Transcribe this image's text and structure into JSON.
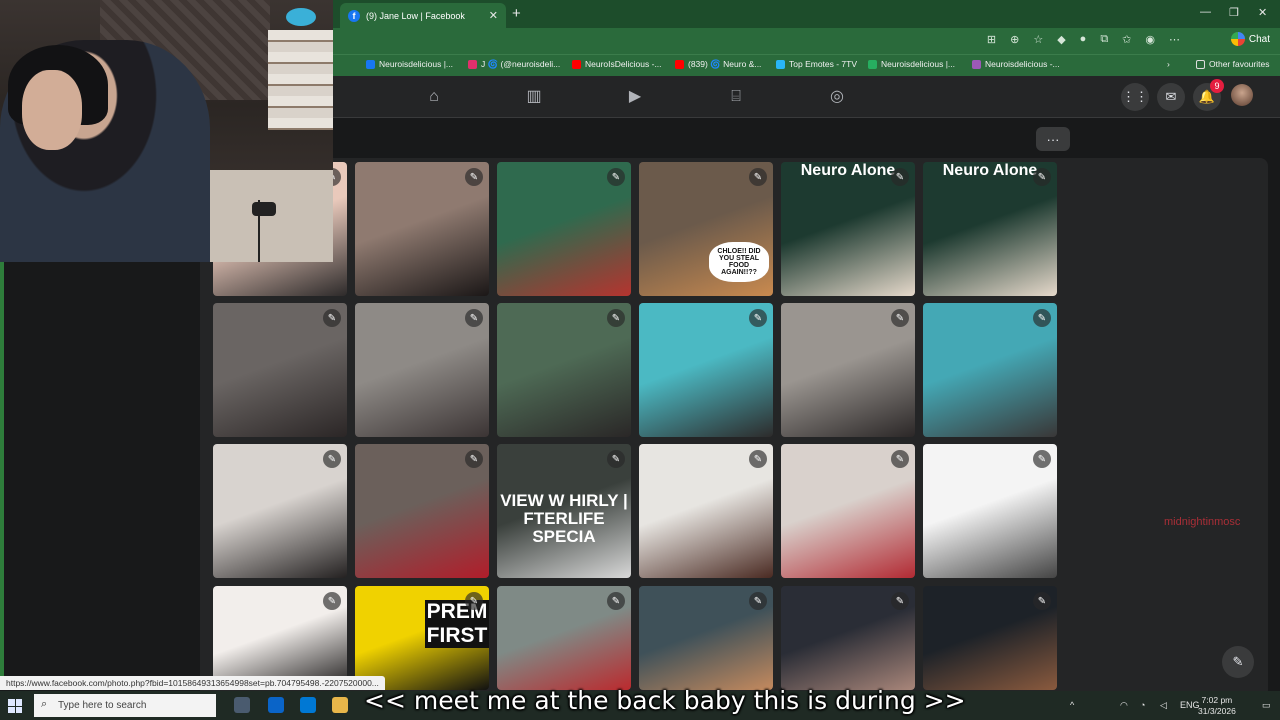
{
  "browser": {
    "tab_title": "(9) Jane Low | Facebook",
    "chat_label": "Chat",
    "other_favourites": "Other favourites",
    "bookmarks": [
      {
        "label": "Neuroisdelicious |...",
        "color": "#1877f2"
      },
      {
        "label": "J 🌀 (@neuroisdeli...",
        "color": "#e1306c"
      },
      {
        "label": "NeuroIsDelicious -...",
        "color": "#ff0000"
      },
      {
        "label": "(839) 🌀 Neuro &...",
        "color": "#ff0000"
      },
      {
        "label": "Top Emotes - 7TV",
        "color": "#29b6f6"
      },
      {
        "label": "Neuroisdelicious |...",
        "color": "#27ae60"
      },
      {
        "label": "Neuroisdelicious -...",
        "color": "#9b59b6"
      }
    ]
  },
  "facebook": {
    "nav_icons": [
      "home-icon",
      "dashboard-icon",
      "video-icon",
      "marketplace-icon",
      "groups-icon"
    ],
    "notification_count": "9",
    "more_label": "···",
    "photos": [
      {
        "name": "photo-selfie-smile",
        "colors": [
          "#e9c9bb",
          "#2d2a2a"
        ]
      },
      {
        "name": "photo-dark-hair-portrait",
        "colors": [
          "#8f7a70",
          "#1b1717"
        ]
      },
      {
        "name": "photo-ubisoft-card",
        "colors": [
          "#2f6a4e",
          "#b5342f"
        ]
      },
      {
        "name": "photo-dog-chloe",
        "colors": [
          "#6b5a4b",
          "#c98a4f"
        ],
        "caption": "CHLOE!! DID YOU STEAL FOOD AGAIN!!??"
      },
      {
        "name": "photo-neuro-alone-note-1",
        "colors": [
          "#1d3a30",
          "#e6d9cb"
        ],
        "caption": "Neuro Alone"
      },
      {
        "name": "photo-neuro-alone-note-2",
        "colors": [
          "#1d3a30",
          "#e6d9cb"
        ],
        "caption": "Neuro Alone"
      },
      {
        "name": "photo-two-selfie-1",
        "colors": [
          "#6a6563",
          "#2b2626"
        ]
      },
      {
        "name": "photo-two-selfie-2",
        "colors": [
          "#8e8a86",
          "#3b3434"
        ]
      },
      {
        "name": "photo-selfie-green-room",
        "colors": [
          "#4e6a55",
          "#2a2727"
        ]
      },
      {
        "name": "photo-pool-table-1",
        "colors": [
          "#4bb9c3",
          "#2d2b2b"
        ]
      },
      {
        "name": "photo-two-selfie-3",
        "colors": [
          "#9a9590",
          "#2b2727"
        ]
      },
      {
        "name": "photo-pool-table-2",
        "colors": [
          "#44a8b5",
          "#393737"
        ]
      },
      {
        "name": "photo-toaster-selfie",
        "colors": [
          "#d8d3cf",
          "#242121"
        ]
      },
      {
        "name": "photo-two-selfie-red",
        "colors": [
          "#6b605b",
          "#b11d2a"
        ]
      },
      {
        "name": "photo-afterlife-special",
        "colors": [
          "#3a403c",
          "#d8d8d8"
        ],
        "caption": "VIEW W HIRLY | FTERLIFE SPECIA"
      },
      {
        "name": "photo-steak-dinner",
        "colors": [
          "#e7e5e1",
          "#4a2a22"
        ]
      },
      {
        "name": "photo-two-selfie-white-hair",
        "colors": [
          "#d9d1cc",
          "#b22a33"
        ]
      },
      {
        "name": "photo-handwritten-notes",
        "colors": [
          "#f4f4f4",
          "#444444"
        ]
      },
      {
        "name": "photo-face-mask-selfie",
        "colors": [
          "#f2eeeb",
          "#1c1a1a"
        ]
      },
      {
        "name": "photo-premiere-first",
        "colors": [
          "#f0d200",
          "#111111"
        ],
        "caption": "PREM FIRST"
      },
      {
        "name": "photo-street-selfie",
        "colors": [
          "#7f8a86",
          "#bb2a2e"
        ]
      },
      {
        "name": "photo-dog-desk",
        "colors": [
          "#3f5159",
          "#c58a5e"
        ]
      },
      {
        "name": "photo-group-night",
        "colors": [
          "#2a2d36",
          "#a9867a"
        ]
      },
      {
        "name": "photo-group-candles",
        "colors": [
          "#1d2228",
          "#8a5a3e"
        ]
      }
    ]
  },
  "status_url": "https://www.facebook.com/photo.php?fbid=10158649313654998set=pb.704795498.-2207520000...",
  "watermark": "midnightinmosc",
  "subtitle": "<< meet me at the back baby this is during >>",
  "taskbar": {
    "search_placeholder": "Type here to search",
    "language": "ENG",
    "time": "7:02 pm",
    "date": "31/3/2026"
  }
}
